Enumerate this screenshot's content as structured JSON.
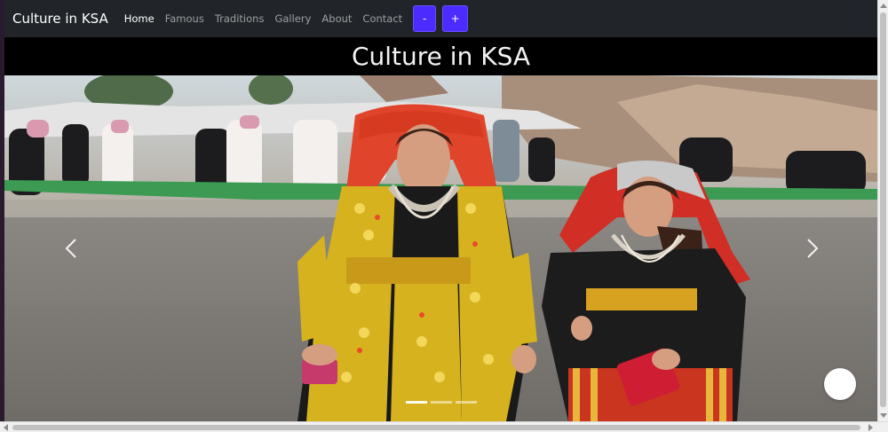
{
  "navbar": {
    "brand": "Culture in KSA",
    "links": [
      {
        "label": "Home",
        "active": true
      },
      {
        "label": "Famous",
        "active": false
      },
      {
        "label": "Traditions",
        "active": false
      },
      {
        "label": "Gallery",
        "active": false
      },
      {
        "label": "About",
        "active": false
      },
      {
        "label": "Contact",
        "active": false
      }
    ],
    "font_decrease_label": "-",
    "font_increase_label": "+"
  },
  "header": {
    "title": "Culture in KSA"
  },
  "carousel": {
    "slide_count": 3,
    "active_slide": 1,
    "prev_icon": "chevron-left-icon",
    "next_icon": "chevron-right-icon"
  },
  "colors": {
    "navbar_bg": "#212529",
    "title_bar_bg": "#000000",
    "font_button_bg": "#4b2bff"
  }
}
